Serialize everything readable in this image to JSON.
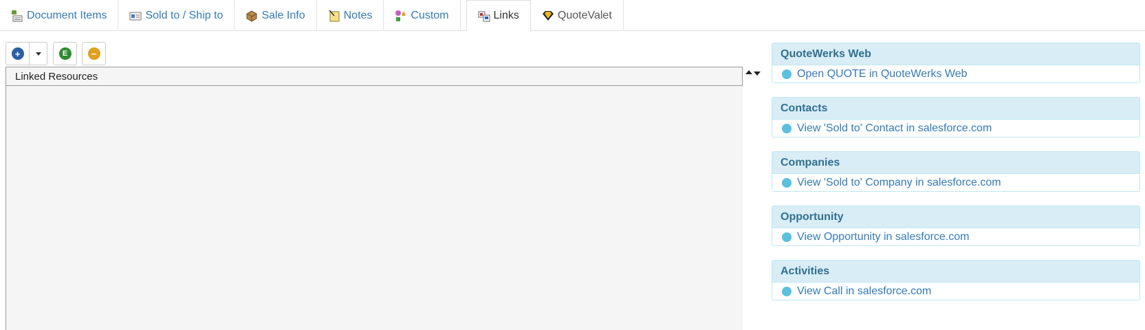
{
  "tabs": [
    {
      "label": "Document Items",
      "icon": "document-items-icon"
    },
    {
      "label": "Sold to / Ship to",
      "icon": "address-card-icon"
    },
    {
      "label": "Sale Info",
      "icon": "package-icon"
    },
    {
      "label": "Notes",
      "icon": "notepad-icon"
    },
    {
      "label": "Custom",
      "icon": "shapes-icon"
    },
    {
      "label": "Links",
      "icon": "links-icon",
      "active": true
    },
    {
      "label": "QuoteValet",
      "icon": "quotevalet-icon"
    }
  ],
  "toolbar": {
    "add_glyph": "+",
    "e_glyph": "E",
    "remove_glyph": "−"
  },
  "grid": {
    "column_header": "Linked Resources"
  },
  "panels": [
    {
      "title": "QuoteWerks Web",
      "link": "Open QUOTE in QuoteWerks Web"
    },
    {
      "title": "Contacts",
      "link": "View 'Sold to' Contact in salesforce.com"
    },
    {
      "title": "Companies",
      "link": "View 'Sold to' Company in salesforce.com"
    },
    {
      "title": "Opportunity",
      "link": "View Opportunity in salesforce.com"
    },
    {
      "title": "Activities",
      "link": "View Call in salesforce.com"
    }
  ],
  "colors": {
    "link": "#337ab7",
    "panel_heading_bg": "#d9edf7",
    "panel_heading_text": "#31708f",
    "bullet": "#5bc0de"
  }
}
